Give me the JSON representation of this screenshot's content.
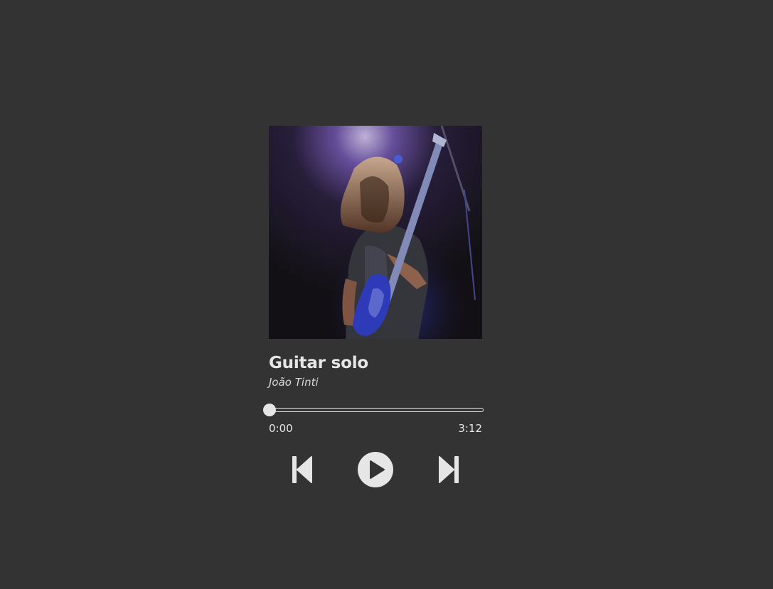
{
  "track": {
    "title": "Guitar solo",
    "artist": "João Tinti"
  },
  "progress": {
    "current_time": "0:00",
    "duration": "3:12",
    "fraction": 0.0
  },
  "controls": {
    "prev_icon": "skip-previous-icon",
    "play_icon": "play-circle-icon",
    "next_icon": "skip-next-icon"
  },
  "colors": {
    "background": "#333333",
    "foreground": "#e6e6e6"
  }
}
